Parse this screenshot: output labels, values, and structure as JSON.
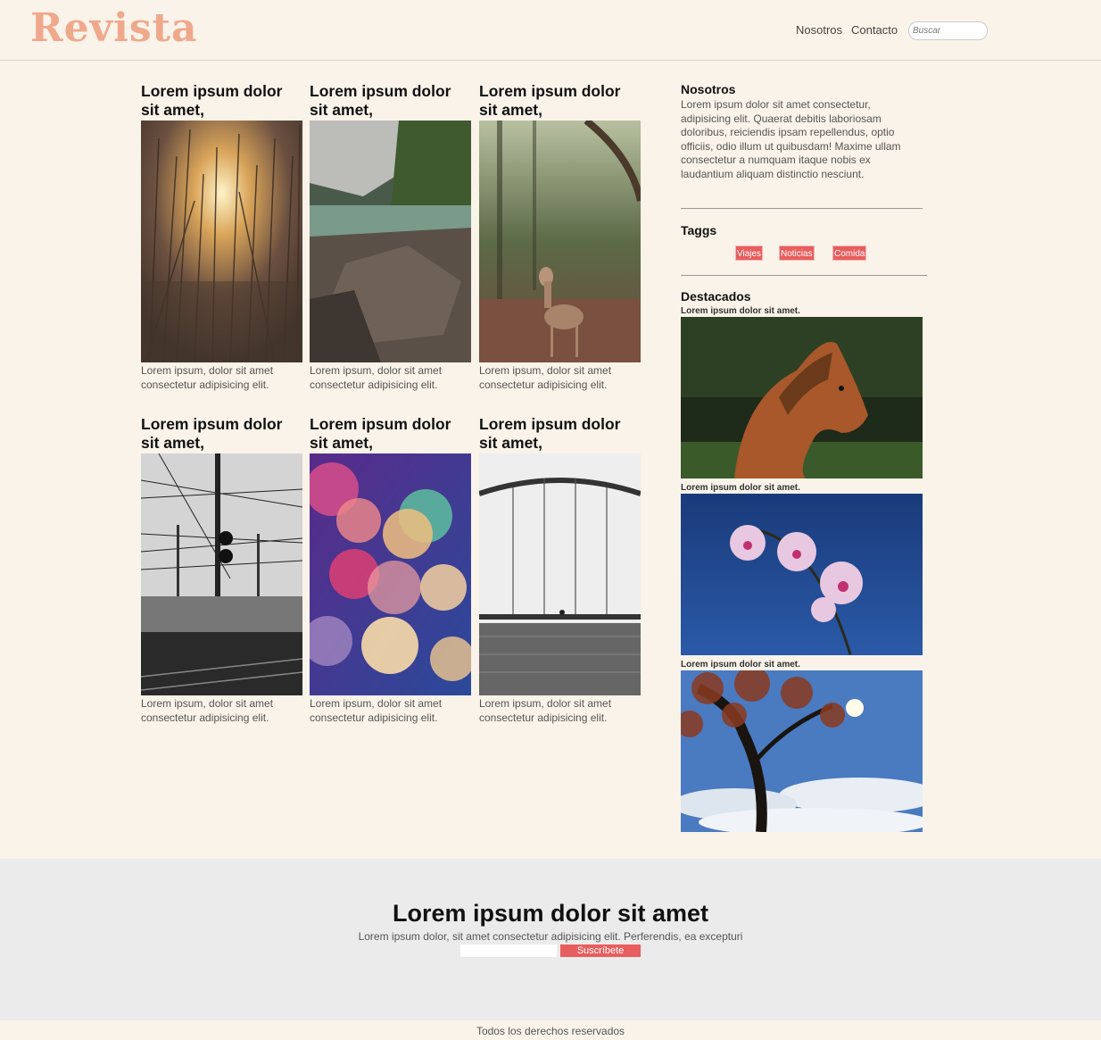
{
  "header": {
    "logo": "Revista",
    "nav": [
      "Nosotros",
      "Contacto"
    ],
    "search_placeholder": "Buscar"
  },
  "articles": [
    {
      "title": "Lorem ipsum dolor sit amet,",
      "text": "Lorem ipsum, dolor sit amet consectetur adipisicing elit.",
      "image": "sunset-grass-image"
    },
    {
      "title": "Lorem ipsum dolor sit amet,",
      "text": "Lorem ipsum, dolor sit amet consectetur adipisicing elit.",
      "image": "river-rocks-image"
    },
    {
      "title": "Lorem ipsum dolor sit amet,",
      "text": "Lorem ipsum, dolor sit amet consectetur adipisicing elit.",
      "image": "fawn-forest-image"
    },
    {
      "title": "Lorem ipsum dolor sit amet,",
      "text": "Lorem ipsum, dolor sit amet consectetur adipisicing elit.",
      "image": "railway-wires-image"
    },
    {
      "title": "Lorem ipsum dolor sit amet,",
      "text": "Lorem ipsum, dolor sit amet consectetur adipisicing elit.",
      "image": "bokeh-lights-image"
    },
    {
      "title": "Lorem ipsum dolor sit amet,",
      "text": "Lorem ipsum, dolor sit amet consectetur adipisicing elit.",
      "image": "bridge-cyclist-image"
    }
  ],
  "sidebar": {
    "about_heading": "Nosotros",
    "about_text": "Lorem ipsum dolor sit amet consectetur, adipisicing elit. Quaerat debitis laboriosam doloribus, reiciendis ipsam repellendus, optio officiis, odio illum ut quibusdam! Maxime ullam consectetur a numquam itaque nobis ex laudantium aliquam distinctio nesciunt.",
    "tags_heading": "Taggs",
    "tags": [
      "Viajes",
      "Noticias",
      "Comida"
    ],
    "featured_heading": "Destacados",
    "featured": [
      {
        "caption": "Lorem ipsum dolor sit amet.",
        "image": "horse-image"
      },
      {
        "caption": "Lorem ipsum dolor sit amet.",
        "image": "orchid-image"
      },
      {
        "caption": "Lorem ipsum dolor sit amet.",
        "image": "tree-sky-image"
      }
    ]
  },
  "subscribe": {
    "title": "Lorem ipsum dolor sit amet",
    "text": "Lorem ipsum dolor, sit amet consectetur adipisicing elit. Perferendis, ea excepturi",
    "button": "Suscríbete"
  },
  "footer": "Todos los derechos reservados",
  "colors": {
    "logo": "#f0a88d",
    "accent": "#e85d5d",
    "background": "#faf3e9",
    "band": "#ebebeb"
  }
}
